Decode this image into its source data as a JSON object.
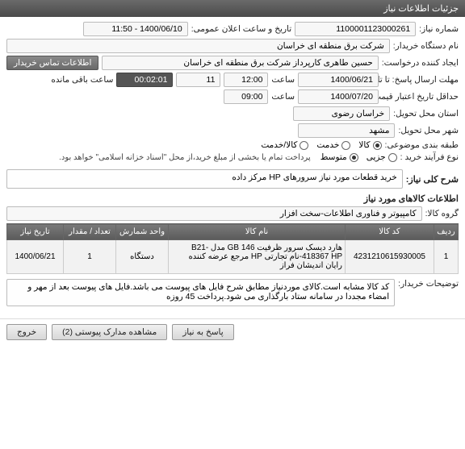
{
  "header": {
    "title": "جزئیات اطلاعات نیاز"
  },
  "fields": {
    "need_number_label": "شماره نیاز:",
    "need_number": "1100001123000261",
    "public_announce_label": "تاریخ و ساعت اعلان عمومی:",
    "public_announce": "1400/06/10 - 11:50",
    "buyer_org_label": "نام دستگاه خریدار:",
    "buyer_org": "شرکت برق منطقه ای خراسان",
    "creator_label": "ایجاد کننده درخواست:",
    "creator": "حسین طاهری کارپرداز شرکت برق منطقه ای خراسان",
    "contact_btn": "اطلاعات تماس خریدار",
    "deadline_send_label": "مهلت ارسال پاسخ: تا تاریخ:",
    "deadline_send_date": "1400/06/21",
    "time_label": "ساعت",
    "deadline_send_hour": "12:00",
    "deadline_send_min": "11",
    "remaining": "00:02:01",
    "remaining_label": "ساعت باقی مانده",
    "validity_label": "حداقل تاریخ اعتبار قیمت: تا تاریخ:",
    "validity_date": "1400/07/20",
    "validity_hour": "09:00",
    "province_label": "استان محل تحویل:",
    "province": "خراسان رضوی",
    "city_label": "شهر محل تحویل:",
    "city": "مشهد",
    "category_label": "طبقه بندی موضوعی:",
    "cat_opts": [
      {
        "label": "کالا",
        "sel": true
      },
      {
        "label": "خدمت",
        "sel": false
      },
      {
        "label": "کالا/خدمت",
        "sel": false
      }
    ],
    "process_label": "نوع فرآیند خرید :",
    "proc_opts": [
      {
        "label": "جزیی",
        "sel": false
      },
      {
        "label": "متوسط",
        "sel": true
      }
    ],
    "process_hint": "پرداخت تمام یا بخشی از مبلغ خرید،از محل \"اسناد خزانه اسلامی\" خواهد بود.",
    "desc_label": "شرح کلی نیاز:",
    "desc_value": "خرید قطعات مورد نیاز سرورهای HP مرکز داده",
    "items_title": "اطلاعات کالاهای مورد نیاز",
    "group_label": "گروه کالا:",
    "group_value": "کامپیوتر و فناوری اطلاعات-سخت افزار",
    "note_label": "توضیحات خریدار:",
    "note_value": "کد کالا مشابه است.کالای موردنیاز مطابق شرح فایل های پیوست می باشد.فایل های پیوست بعد از مهر و امضاء مجددا در سامانه ستاد بارگذاری می شود.پرداخت 45 روزه"
  },
  "table": {
    "headers": [
      "ردیف",
      "کد کالا",
      "نام کالا",
      "واحد شمارش",
      "تعداد / مقدار",
      "تاریخ نیاز"
    ],
    "rows": [
      {
        "idx": "1",
        "code": "4231210615930005",
        "name": "هارد دیسک سرور ظرفیت GB 146 مدل B21-418367 HP-نام تجارتی HP مرجع عرضه کننده رایان اندیشان فراز",
        "unit": "دستگاه",
        "qty": "1",
        "date": "1400/06/21"
      }
    ]
  },
  "footer": {
    "reply": "پاسخ به نیاز",
    "attach": "مشاهده مدارک پیوستی (2)",
    "exit": "خروج"
  }
}
